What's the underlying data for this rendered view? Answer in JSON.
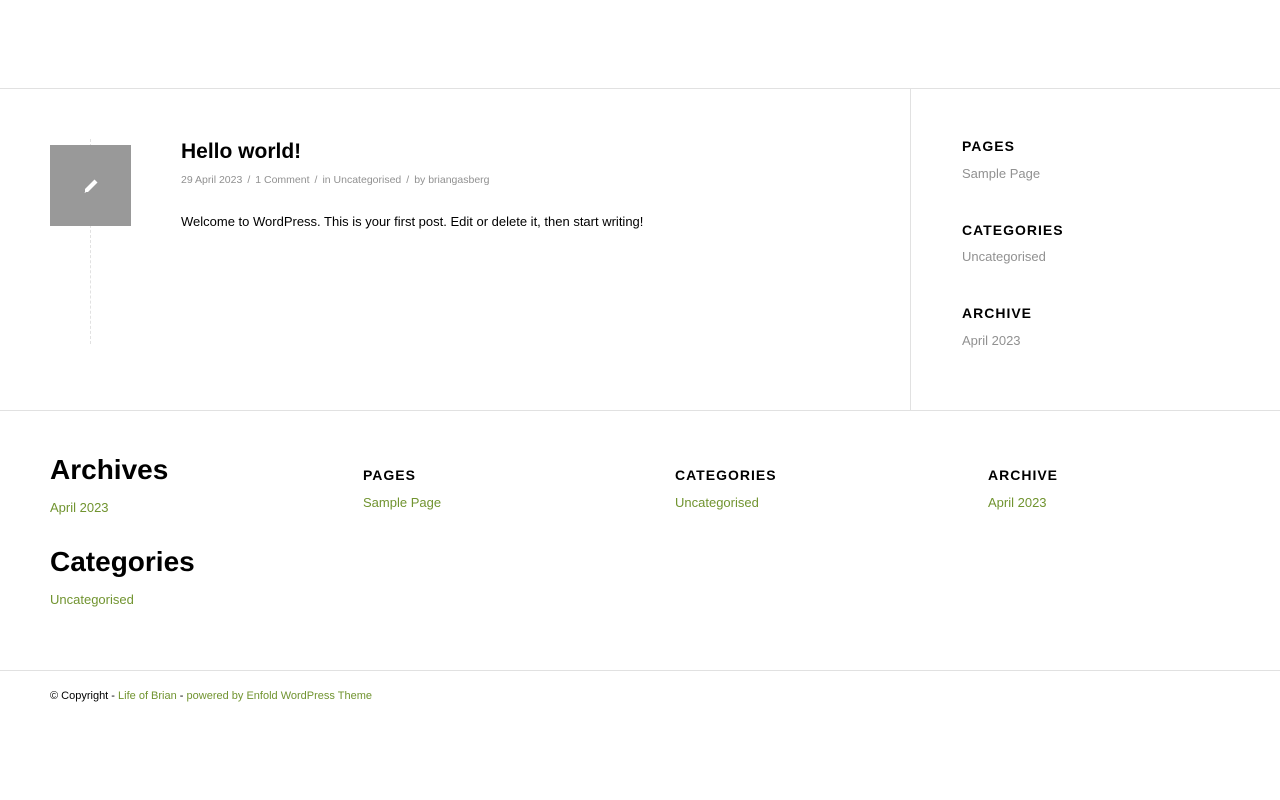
{
  "post": {
    "title": "Hello world!",
    "date": "29 April 2023",
    "comments": "1 Comment",
    "in_label": "in",
    "category": "Uncategorised",
    "by_label": "by",
    "author": "briangasberg",
    "separator": "/",
    "excerpt": "Welcome to WordPress. This is your first post. Edit or delete it, then start writing!",
    "icon": "pencil-icon"
  },
  "sidebar": {
    "pages": {
      "title": "PAGES",
      "link": "Sample Page"
    },
    "categories": {
      "title": "CATEGORIES",
      "link": "Uncategorised"
    },
    "archive": {
      "title": "ARCHIVE",
      "link": "April 2023"
    }
  },
  "footer": {
    "archives": {
      "title": "Archives",
      "link": "April 2023"
    },
    "categories_big": {
      "title": "Categories",
      "link": "Uncategorised"
    },
    "pages": {
      "title": "PAGES",
      "link": "Sample Page"
    },
    "categories": {
      "title": "CATEGORIES",
      "link": "Uncategorised"
    },
    "archive": {
      "title": "ARCHIVE",
      "link": "April 2023"
    }
  },
  "socket": {
    "copyright_prefix": "© Copyright -",
    "site_name": "Life of Brian",
    "dash": "-",
    "powered_by": "powered by Enfold WordPress Theme"
  },
  "colors": {
    "accent_green": "#719430",
    "meta_grey": "#919191",
    "icon_bg": "#999999",
    "border": "#e1e1e1"
  }
}
